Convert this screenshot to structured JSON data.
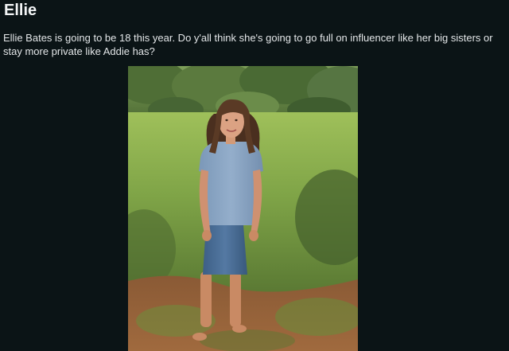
{
  "post": {
    "title": "Ellie",
    "body": "Ellie Bates is going to be 18 this year. Do y'all think she's going to go full on influencer like her big sisters or stay more private like Addie has?"
  },
  "image": {
    "subject": "photo"
  },
  "colors": {
    "background": "#0b1416",
    "text": "#f2f4f5"
  }
}
